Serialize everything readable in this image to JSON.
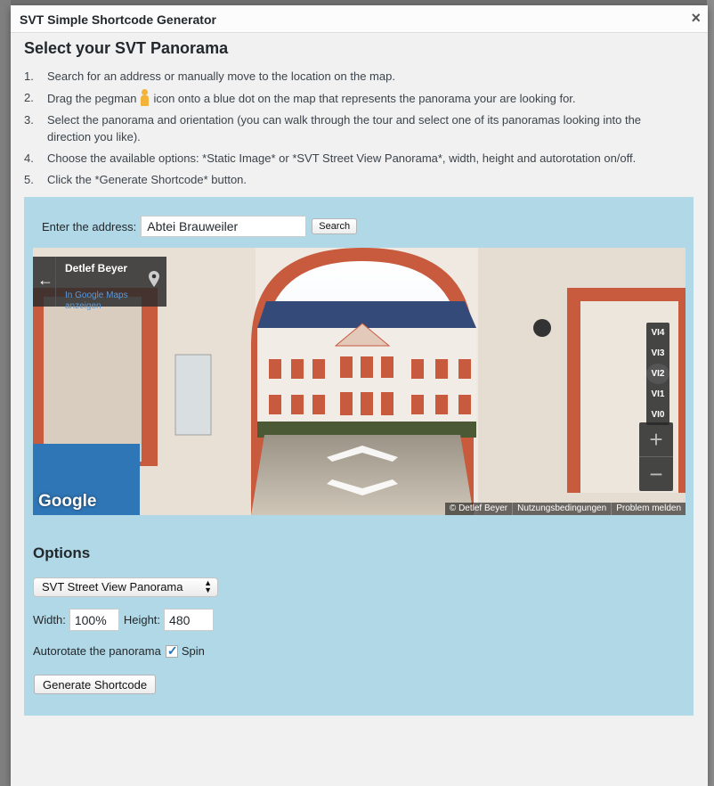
{
  "dialog": {
    "title": "SVT Simple Shortcode Generator",
    "close_label": "×"
  },
  "heading": "Select your SVT Panorama",
  "steps": [
    {
      "num": "1.",
      "text": "Search for an address or manually move to the location on the map."
    },
    {
      "num": "2.",
      "text_before": "Drag the pegman",
      "text_after": "icon onto a blue dot on the map that represents the panorama your are looking for."
    },
    {
      "num": "3.",
      "text": "Select the panorama and orientation (you can walk through the tour and select one of its panoramas looking into the direction you like)."
    },
    {
      "num": "4.",
      "text": "Choose the available options: *Static Image* or *SVT Street View Panorama*, width, height and autorotation on/off."
    },
    {
      "num": "5.",
      "text": "Click the *Generate Shortcode* button."
    }
  ],
  "address": {
    "label": "Enter the address:",
    "value": "Abtei Brauweiler",
    "search_label": "Search"
  },
  "streetview": {
    "author": "Detlef Beyer",
    "maps_link": "In Google Maps anzeigen",
    "levels": [
      "VI4",
      "VI3",
      "VI2",
      "VI1",
      "VI0"
    ],
    "active_level": "VI2",
    "zoom_in": "+",
    "zoom_out": "−",
    "logo": "Google",
    "attribution": [
      "© Detlef Beyer",
      "Nutzungsbedingungen",
      "Problem melden"
    ]
  },
  "options": {
    "title": "Options",
    "type_selected": "SVT Street View Panorama",
    "width_label": "Width:",
    "width_value": "100%",
    "height_label": "Height:",
    "height_value": "480",
    "autorotate_label": "Autorotate the panorama",
    "spin_label": "Spin",
    "spin_checked": true,
    "generate_label": "Generate Shortcode"
  },
  "colors": {
    "panel_bg": "#b0d8e6",
    "link": "#5b9bdc",
    "check": "#2271b1"
  }
}
